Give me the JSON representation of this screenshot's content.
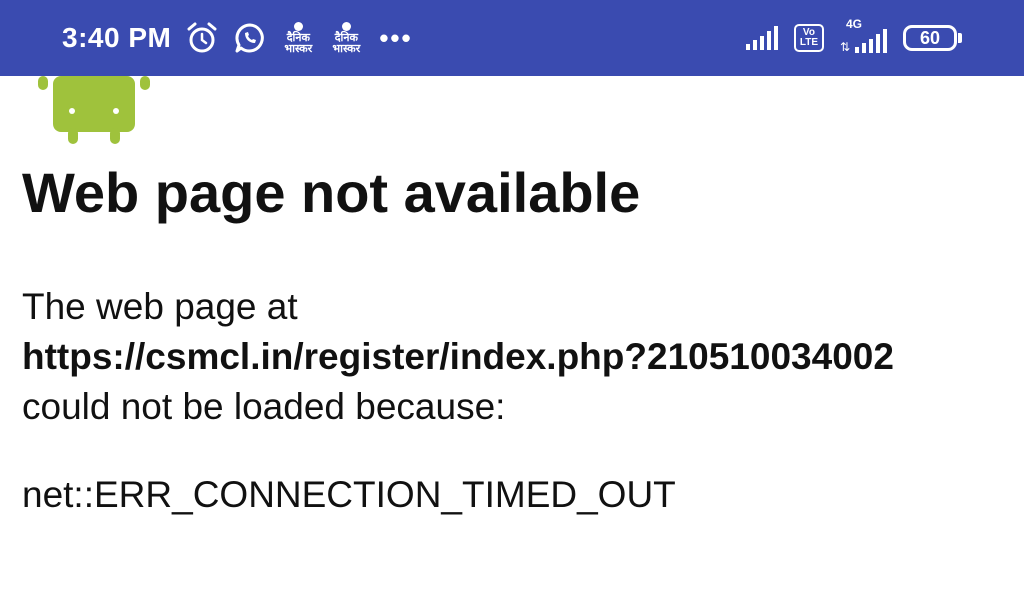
{
  "status_bar": {
    "time": "3:40 PM",
    "notifications": [
      {
        "icon": "alarm-icon"
      },
      {
        "icon": "whatsapp-icon"
      },
      {
        "icon": "dainik-bhaskar-icon",
        "text": "दैनिक भास्कर"
      },
      {
        "icon": "dainik-bhaskar-icon",
        "text": "दैनिक भास्कर"
      }
    ],
    "more": "•••",
    "volte_label": [
      "Vo",
      "LTE"
    ],
    "network_label": "4G",
    "battery": "60"
  },
  "page": {
    "title": "Web page not available",
    "message_prefix": "The web page at",
    "url": "https://csmcl.in/register/index.php?210510034002",
    "message_suffix": "could not be loaded because:",
    "error_code": "net::ERR_CONNECTION_TIMED_OUT"
  },
  "colors": {
    "status_bar": "#3a4bb0",
    "android_green": "#9fc23c"
  }
}
